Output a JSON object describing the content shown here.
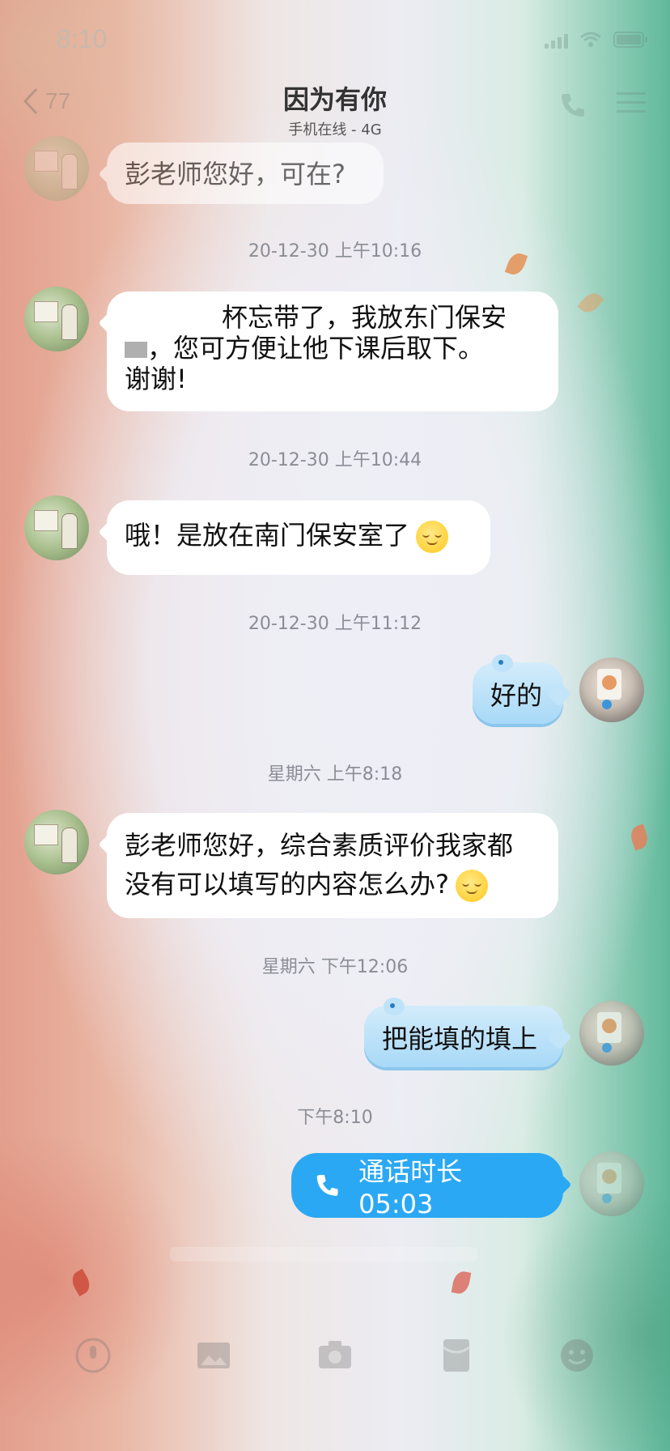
{
  "status_bar": {
    "time": "8:10"
  },
  "nav": {
    "back_count": "77",
    "title": "因为有你",
    "subtitle": "手机在线 - 4G"
  },
  "messages": [
    {
      "text": "彭老师您好，可在?"
    },
    {
      "timestamp": "20-12-30 上午10:16"
    },
    {
      "line1": "杯忘带了，我放东门保安",
      "line2": "，您可方便让他下课后取下。",
      "line3": "谢谢!"
    },
    {
      "timestamp": "20-12-30 上午10:44"
    },
    {
      "text": "哦！是放在南门保安室了"
    },
    {
      "timestamp": "20-12-30 上午11:12"
    },
    {
      "text": "好的"
    },
    {
      "timestamp": "星期六 上午8:18"
    },
    {
      "line1": "彭老师您好，综合素质评价我家都",
      "line2": "没有可以填写的内容怎么办?"
    },
    {
      "timestamp": "星期六 下午12:06"
    },
    {
      "text": "把能填的填上"
    },
    {
      "timestamp": "下午8:10"
    },
    {
      "call_label": "通话时长 05:03"
    }
  ],
  "colors": {
    "call_bubble": "#2ba8f4",
    "blue_bubble": "#a8d9f7",
    "timestamp_text": "#8b8d96"
  },
  "icons": {
    "toolbar": [
      "voice-icon",
      "image-icon",
      "camera-icon",
      "red-packet-icon",
      "emoji-icon"
    ]
  }
}
